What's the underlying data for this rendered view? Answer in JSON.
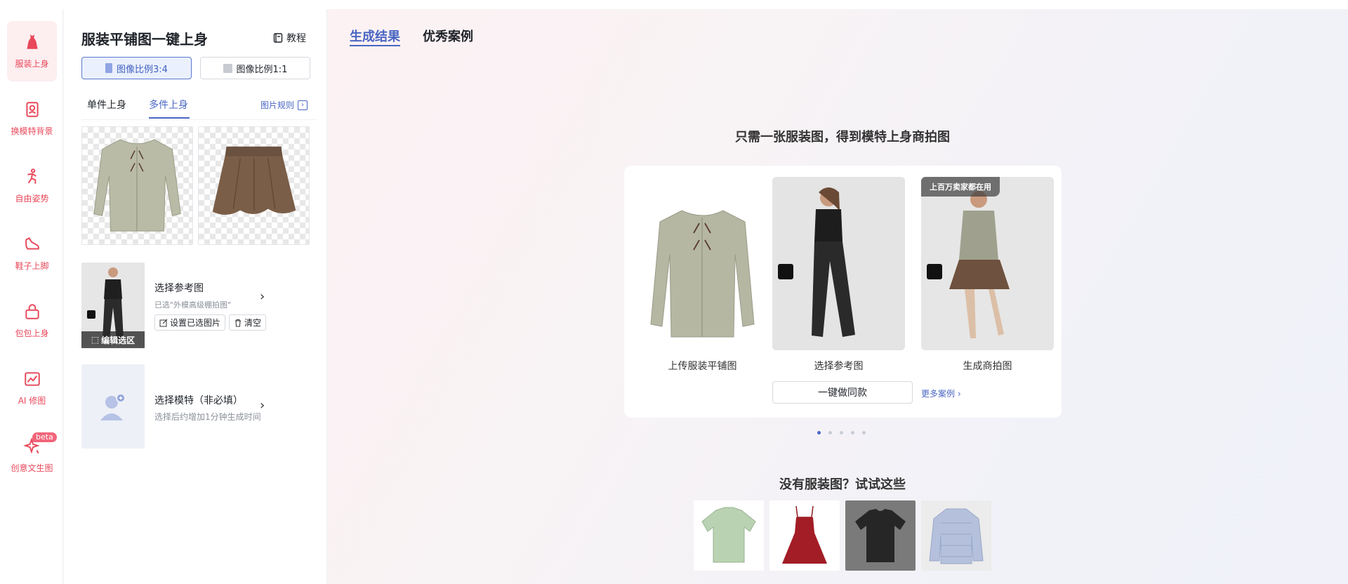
{
  "rail": {
    "items": [
      {
        "label": "服装上身",
        "icon": "dress-icon",
        "active": true
      },
      {
        "label": "换模特背景",
        "icon": "portrait-icon"
      },
      {
        "label": "自由姿势",
        "icon": "pose-icon"
      },
      {
        "label": "鞋子上脚",
        "icon": "shoe-icon"
      },
      {
        "label": "包包上身",
        "icon": "bag-icon"
      },
      {
        "label": "AI 修图",
        "icon": "photo-edit-icon"
      },
      {
        "label": "创意文生图",
        "icon": "sparkle-icon",
        "badge": "beta"
      }
    ],
    "accent_color": "#e8485a"
  },
  "panel": {
    "title": "服装平铺图一键上身",
    "tutorial_label": "教程",
    "ratio_options": [
      "图像比例3:4",
      "图像比例1:1"
    ],
    "tabs": [
      "单件上身",
      "多件上身"
    ],
    "image_rules_label": "图片规则",
    "reference": {
      "title": "选择参考图",
      "subtitle": "已选\"外模高级棚拍图\"",
      "edit_label": "编辑选区",
      "set_label": "设置已选图片",
      "clear_label": "清空"
    },
    "model": {
      "title": "选择模特（非必填）",
      "subtitle": "选择后约增加1分钟生成时间"
    }
  },
  "main": {
    "tabs": [
      "生成结果",
      "优秀案例"
    ],
    "promo_title": "只需一张服装图，得到模特上身商拍图",
    "demo": {
      "labels": [
        "上传服装平铺图",
        "选择参考图",
        "生成商拍图"
      ],
      "badge": "上百万卖家都在用",
      "same_style_button": "一键做同款",
      "more_cases": "更多案例 ›"
    },
    "carousel_dots": 5,
    "try_title": "没有服装图？试试这些"
  },
  "colors": {
    "brand_blue": "#4a66c3",
    "accent_red": "#e8485a"
  }
}
